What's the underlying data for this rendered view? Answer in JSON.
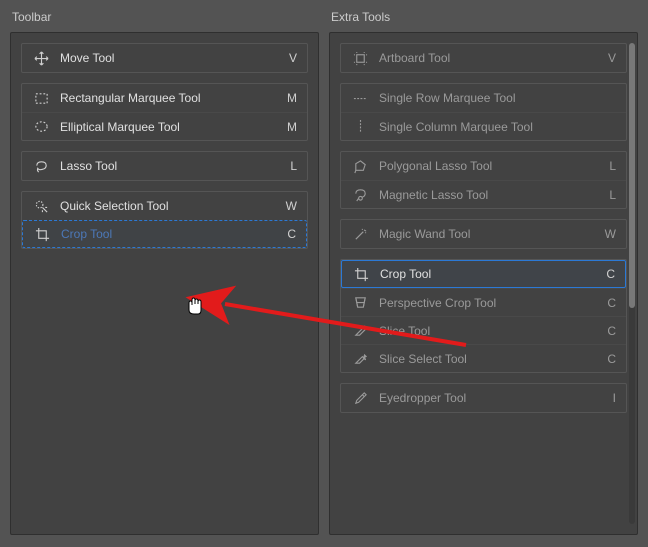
{
  "left": {
    "title": "Toolbar",
    "groups": [
      {
        "items": [
          {
            "icon": "move",
            "label": "Move Tool",
            "shortcut": "V"
          }
        ]
      },
      {
        "items": [
          {
            "icon": "rect-marquee",
            "label": "Rectangular Marquee Tool",
            "shortcut": "M"
          },
          {
            "icon": "ellipse-marquee",
            "label": "Elliptical Marquee Tool",
            "shortcut": "M"
          }
        ]
      },
      {
        "items": [
          {
            "icon": "lasso",
            "label": "Lasso Tool",
            "shortcut": "L"
          }
        ]
      },
      {
        "items": [
          {
            "icon": "quick-select",
            "label": "Quick Selection Tool",
            "shortcut": "W"
          },
          {
            "icon": "crop",
            "label": "Crop Tool",
            "shortcut": "C",
            "ghost": true
          }
        ]
      }
    ]
  },
  "right": {
    "title": "Extra Tools",
    "groups": [
      {
        "dim": true,
        "items": [
          {
            "icon": "artboard",
            "label": "Artboard Tool",
            "shortcut": "V"
          }
        ]
      },
      {
        "dim": true,
        "items": [
          {
            "icon": "single-row",
            "label": "Single Row Marquee Tool",
            "shortcut": ""
          },
          {
            "icon": "single-col",
            "label": "Single Column Marquee Tool",
            "shortcut": ""
          }
        ]
      },
      {
        "dim": true,
        "items": [
          {
            "icon": "poly-lasso",
            "label": "Polygonal Lasso Tool",
            "shortcut": "L"
          },
          {
            "icon": "mag-lasso",
            "label": "Magnetic Lasso Tool",
            "shortcut": "L"
          }
        ]
      },
      {
        "dim": true,
        "items": [
          {
            "icon": "wand",
            "label": "Magic Wand Tool",
            "shortcut": "W"
          }
        ]
      },
      {
        "items": [
          {
            "icon": "crop",
            "label": "Crop Tool",
            "shortcut": "C",
            "highlight": true
          },
          {
            "icon": "persp-crop",
            "label": "Perspective Crop Tool",
            "shortcut": "C",
            "dim": true
          },
          {
            "icon": "slice",
            "label": "Slice Tool",
            "shortcut": "C",
            "dim": true
          },
          {
            "icon": "slice-select",
            "label": "Slice Select Tool",
            "shortcut": "C",
            "dim": true
          }
        ]
      },
      {
        "dim": true,
        "items": [
          {
            "icon": "eyedropper",
            "label": "Eyedropper Tool",
            "shortcut": "I"
          }
        ]
      }
    ]
  }
}
